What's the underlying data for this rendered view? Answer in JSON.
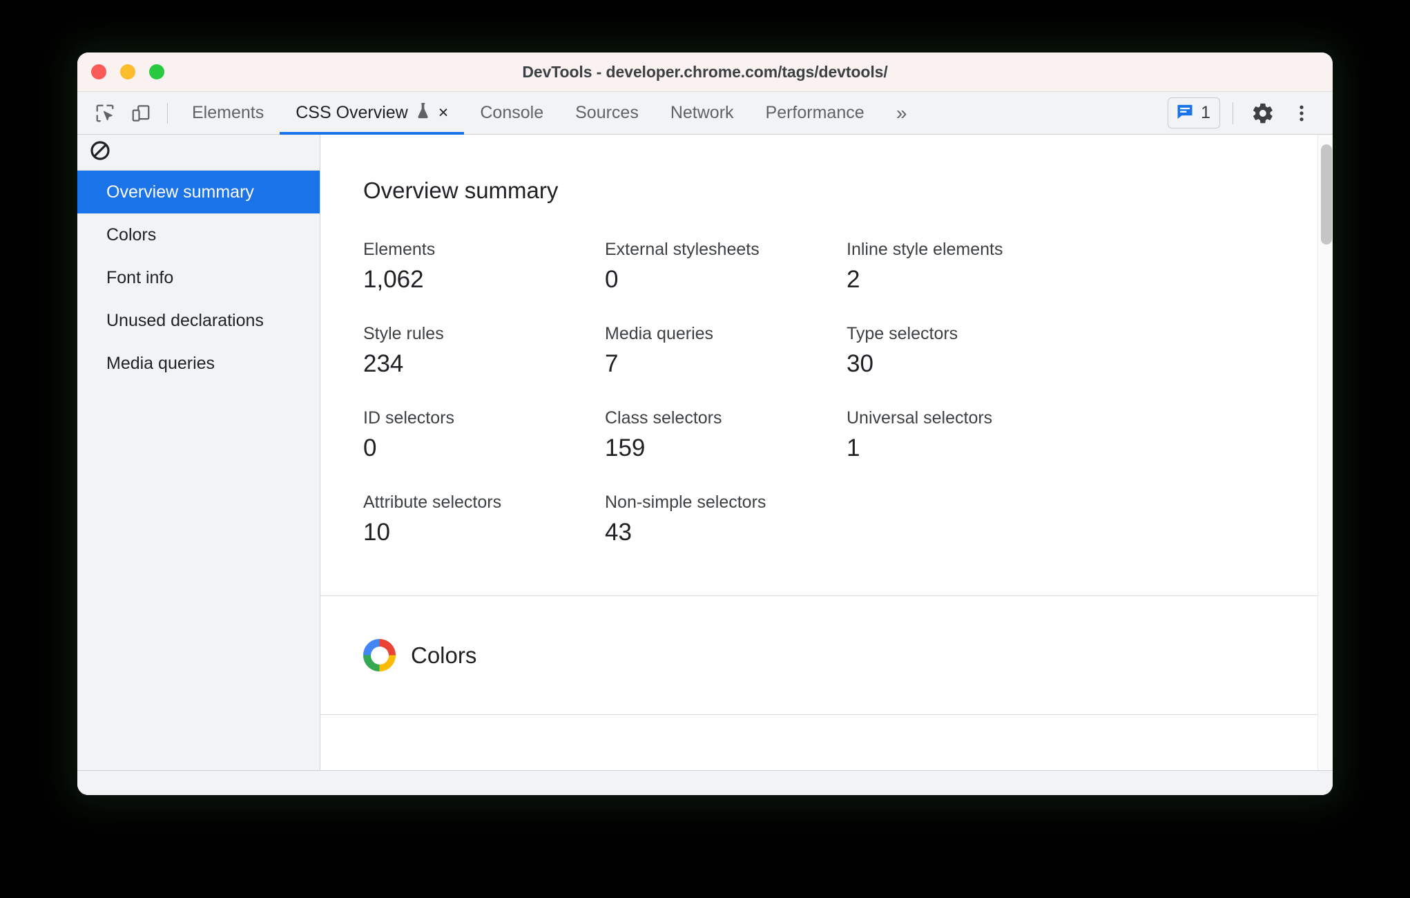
{
  "window": {
    "title": "DevTools - developer.chrome.com/tags/devtools/",
    "traffic_lights": {
      "close": "close-button",
      "minimize": "minimize-button",
      "maximize": "maximize-button"
    }
  },
  "toolbar": {
    "inspect_icon": "inspect-element-icon",
    "device_toolbar_icon": "device-toolbar-icon",
    "overflow_label": "»",
    "messages_count": "1",
    "messages_icon": "message-bubble-icon",
    "settings_icon": "gear-icon",
    "more_icon": "more-vertical-icon"
  },
  "tabs": [
    {
      "label": "Elements",
      "active": false
    },
    {
      "label": "CSS Overview",
      "active": true,
      "experiment_icon": "flask-icon",
      "close_icon": "×"
    },
    {
      "label": "Console",
      "active": false
    },
    {
      "label": "Sources",
      "active": false
    },
    {
      "label": "Network",
      "active": false
    },
    {
      "label": "Performance",
      "active": false
    }
  ],
  "sidebar": {
    "clear_icon": "no-entry-icon",
    "items": [
      {
        "label": "Overview summary",
        "selected": true
      },
      {
        "label": "Colors",
        "selected": false
      },
      {
        "label": "Font info",
        "selected": false
      },
      {
        "label": "Unused declarations",
        "selected": false
      },
      {
        "label": "Media queries",
        "selected": false
      }
    ]
  },
  "main": {
    "summary": {
      "title": "Overview summary",
      "stats": [
        {
          "label": "Elements",
          "value": "1,062"
        },
        {
          "label": "External stylesheets",
          "value": "0"
        },
        {
          "label": "Inline style elements",
          "value": "2"
        },
        {
          "label": "Style rules",
          "value": "234"
        },
        {
          "label": "Media queries",
          "value": "7"
        },
        {
          "label": "Type selectors",
          "value": "30"
        },
        {
          "label": "ID selectors",
          "value": "0"
        },
        {
          "label": "Class selectors",
          "value": "159"
        },
        {
          "label": "Universal selectors",
          "value": "1"
        },
        {
          "label": "Attribute selectors",
          "value": "10"
        },
        {
          "label": "Non-simple selectors",
          "value": "43"
        },
        {
          "label": "",
          "value": ""
        }
      ]
    },
    "colors_section": {
      "title": "Colors",
      "icon": "color-wheel-icon"
    }
  },
  "colors": {
    "accent_blue": "#1a73e8",
    "titlebar_bg": "#faf2f0",
    "chrome_bg": "#f1f3f4",
    "text_primary": "#202124",
    "text_secondary": "#5f6368",
    "google_red": "#ea4335",
    "google_yellow": "#fbbc05",
    "google_green": "#34a853",
    "google_blue": "#4285f4"
  }
}
